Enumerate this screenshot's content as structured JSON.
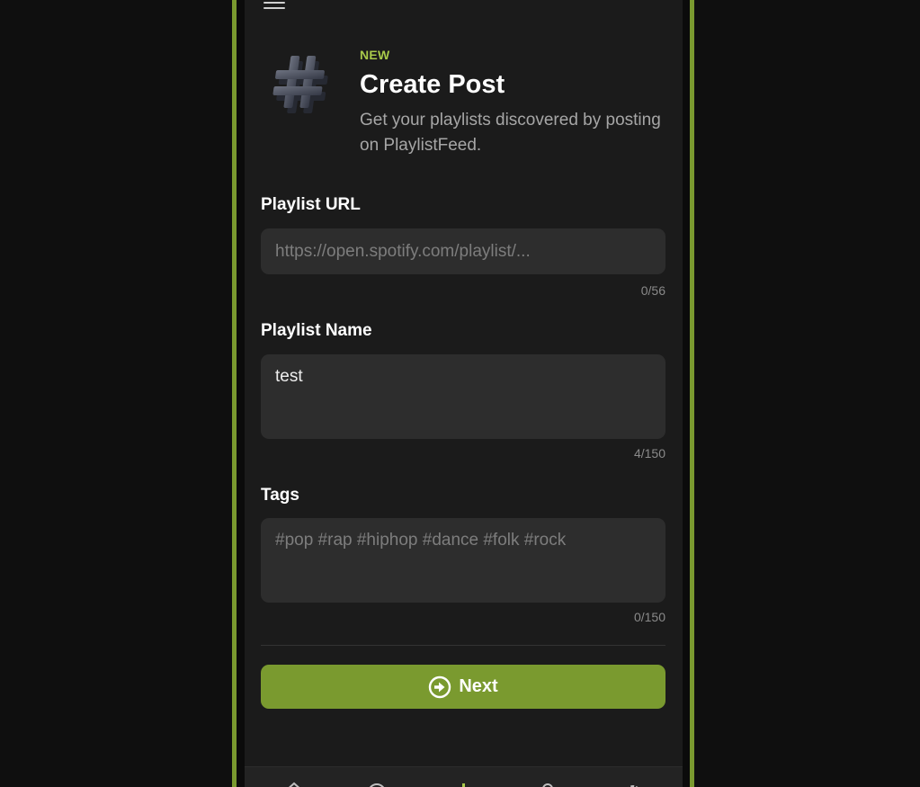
{
  "header": {
    "badge": "NEW",
    "title": "Create Post",
    "subtitle": "Get your playlists discovered by posting on PlaylistFeed."
  },
  "form": {
    "playlist_url": {
      "label": "Playlist URL",
      "placeholder": "https://open.spotify.com/playlist/...",
      "value": "",
      "counter": "0/56"
    },
    "playlist_name": {
      "label": "Playlist Name",
      "value": "test",
      "counter": "4/150"
    },
    "tags": {
      "label": "Tags",
      "placeholder": "#pop #rap #hiphop #dance #folk #rock",
      "value": "",
      "counter": "0/150"
    },
    "next_label": "Next"
  },
  "bottom_nav": {
    "items": [
      "home-icon",
      "explore-icon",
      "create-icon",
      "profile-icon",
      "settings-icon"
    ]
  },
  "colors": {
    "accent": "#7a9a2f",
    "accent_text": "#a8c94a",
    "screen_bg": "#1b1b1b",
    "field_bg": "#2d2d2d"
  }
}
